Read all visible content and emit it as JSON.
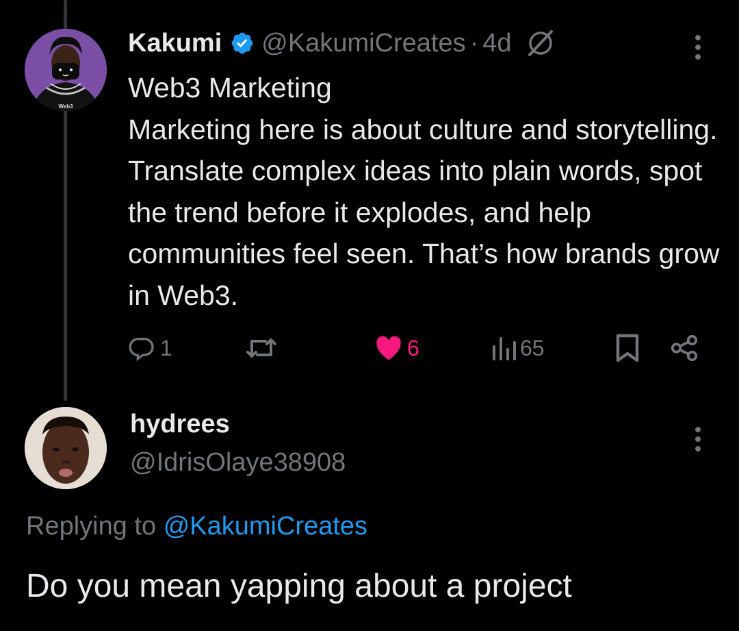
{
  "main_tweet": {
    "display_name": "Kakumi",
    "handle": "@KakumiCreates",
    "separator": "·",
    "age": "4d",
    "avatar_label": "Web3",
    "paragraphs": [
      "Web3 Marketing",
      "Marketing here is about culture and storytelling. Translate complex ideas into plain words, spot the trend before it explodes, and help communities feel seen. That’s how brands grow in Web3."
    ],
    "stats": {
      "replies": "1",
      "likes": "6",
      "views": "65"
    },
    "liked": true
  },
  "reply": {
    "display_name": "hydrees",
    "handle": "@IdrisOlaye38908",
    "replying_prefix": "Replying to",
    "replying_to": "@KakumiCreates",
    "text": "Do you mean yapping about a project"
  },
  "colors": {
    "background": "#000000",
    "primary_text": "#e7e9ea",
    "secondary_text": "#71767b",
    "accent_blue": "#1d9bf0",
    "like_pink": "#f91880",
    "thread_line": "#333639"
  },
  "icons": [
    "verified-badge-icon",
    "grok-icon",
    "more-icon",
    "reply-icon",
    "retweet-icon",
    "heart-icon",
    "views-icon",
    "bookmark-icon",
    "share-icon"
  ]
}
